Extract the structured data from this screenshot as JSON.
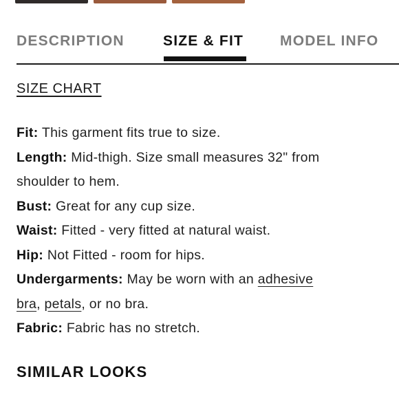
{
  "tabs": {
    "description": "DESCRIPTION",
    "size_fit": "SIZE & FIT",
    "model_info": "MODEL INFO",
    "active": "SIZE & FIT"
  },
  "size_chart_link": "SIZE CHART",
  "details": {
    "fit": {
      "label": "Fit:",
      "value": " This garment fits true to size."
    },
    "length": {
      "label": "Length:",
      "value_line1": " Mid-thigh. Size small measures 32\" from",
      "value_line2": "shoulder to hem."
    },
    "bust": {
      "label": "Bust:",
      "value": " Great for any cup size."
    },
    "waist": {
      "label": "Waist:",
      "value": " Fitted - very fitted at natural waist."
    },
    "hip": {
      "label": "Hip:",
      "value": " Not Fitted - room for hips."
    },
    "undergarments": {
      "label": "Undergarments:",
      "value_prefix": " May be worn with an ",
      "link_adhesive": "adhesive",
      "link_bra": "bra",
      "sep1": ", ",
      "link_petals": "petals",
      "value_suffix": ", or no bra."
    },
    "fabric": {
      "label": "Fabric:",
      "value": " Fabric has no stretch."
    }
  },
  "similar_looks_heading": "SIMILAR LOOKS",
  "colors": {
    "active_tab": "#111111",
    "inactive_tab": "#7c7c7c"
  }
}
